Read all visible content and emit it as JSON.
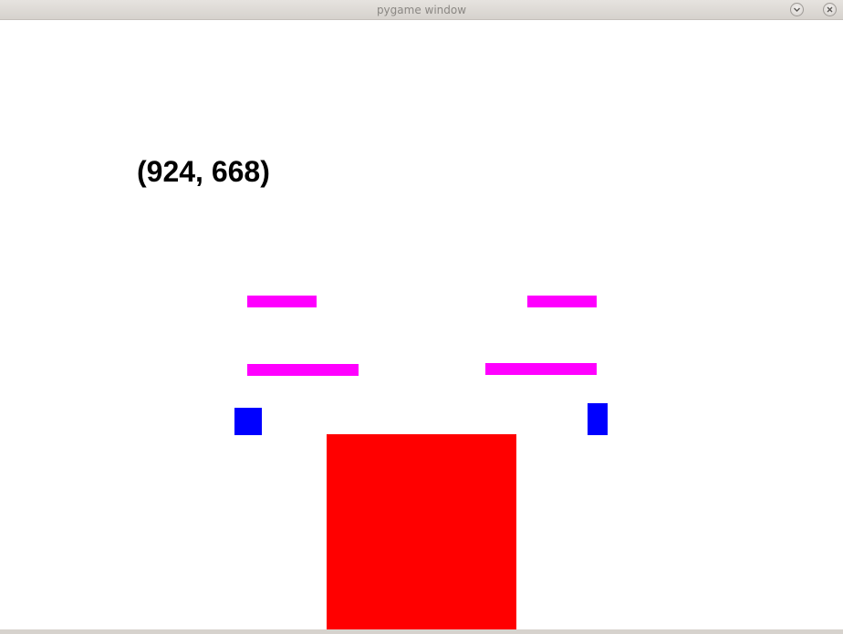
{
  "window": {
    "title": "pygame window"
  },
  "game": {
    "coords_text": "(924, 668)",
    "colors": {
      "background": "#ffffff",
      "platform": "#ff00ff",
      "block": "#0000ff",
      "player": "#ff0000",
      "text": "#000000"
    }
  },
  "icons": {
    "minimize": "chevron-down-icon",
    "close": "close-icon"
  }
}
